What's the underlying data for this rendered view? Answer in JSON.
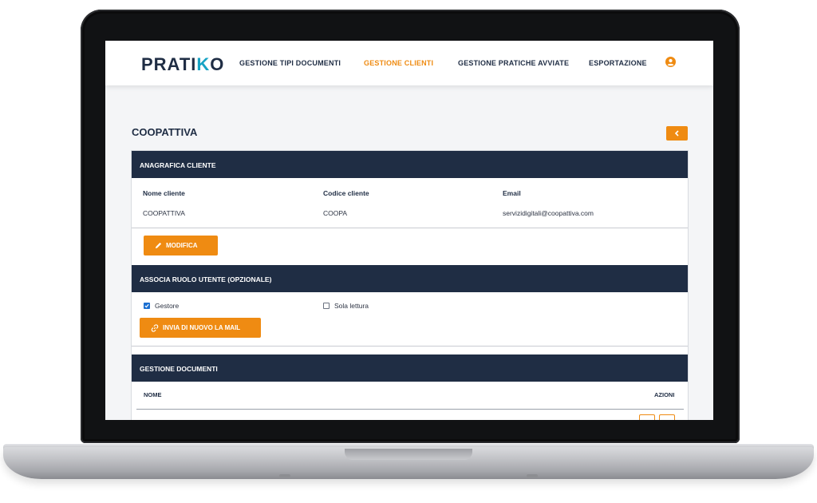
{
  "app": {
    "logo_main": "PRATI",
    "logo_accent": "K",
    "logo_end": "O",
    "colors": {
      "brand": "#1f2d44",
      "accent": "#ef8b12",
      "logo_accent": "#17a3c4"
    }
  },
  "nav": {
    "items": [
      {
        "label": "GESTIONE TIPI DOCUMENTI",
        "active": false
      },
      {
        "label": "GESTIONE CLIENTI",
        "active": true
      },
      {
        "label": "GESTIONE PRATICHE AVVIATE",
        "active": false
      },
      {
        "label": "ESPORTAZIONE",
        "active": false
      }
    ],
    "user_icon": "user-circle-icon"
  },
  "page": {
    "title": "COOPATTIVA",
    "back_icon": "chevron-left-icon"
  },
  "anagrafica": {
    "header": "ANAGRAFICA CLIENTE",
    "fields": [
      {
        "label": "Nome cliente",
        "value": "COOPATTIVA"
      },
      {
        "label": "Codice cliente",
        "value": "COOPA"
      },
      {
        "label": "Email",
        "value": "servizidigitali@coopattiva.com"
      }
    ],
    "edit_label": "MODIFICA",
    "edit_icon": "pencil-icon"
  },
  "ruolo": {
    "header": "ASSOCIA RUOLO UTENTE (OPZIONALE)",
    "options": [
      {
        "label": "Gestore",
        "checked": true
      },
      {
        "label": "Sola lettura",
        "checked": false
      }
    ],
    "resend_label": "INVIA DI NUOVO LA MAIL",
    "resend_icon": "link-icon"
  },
  "documenti": {
    "header": "GESTIONE DOCUMENTI",
    "columns": [
      "NOME",
      "AZIONI"
    ]
  }
}
